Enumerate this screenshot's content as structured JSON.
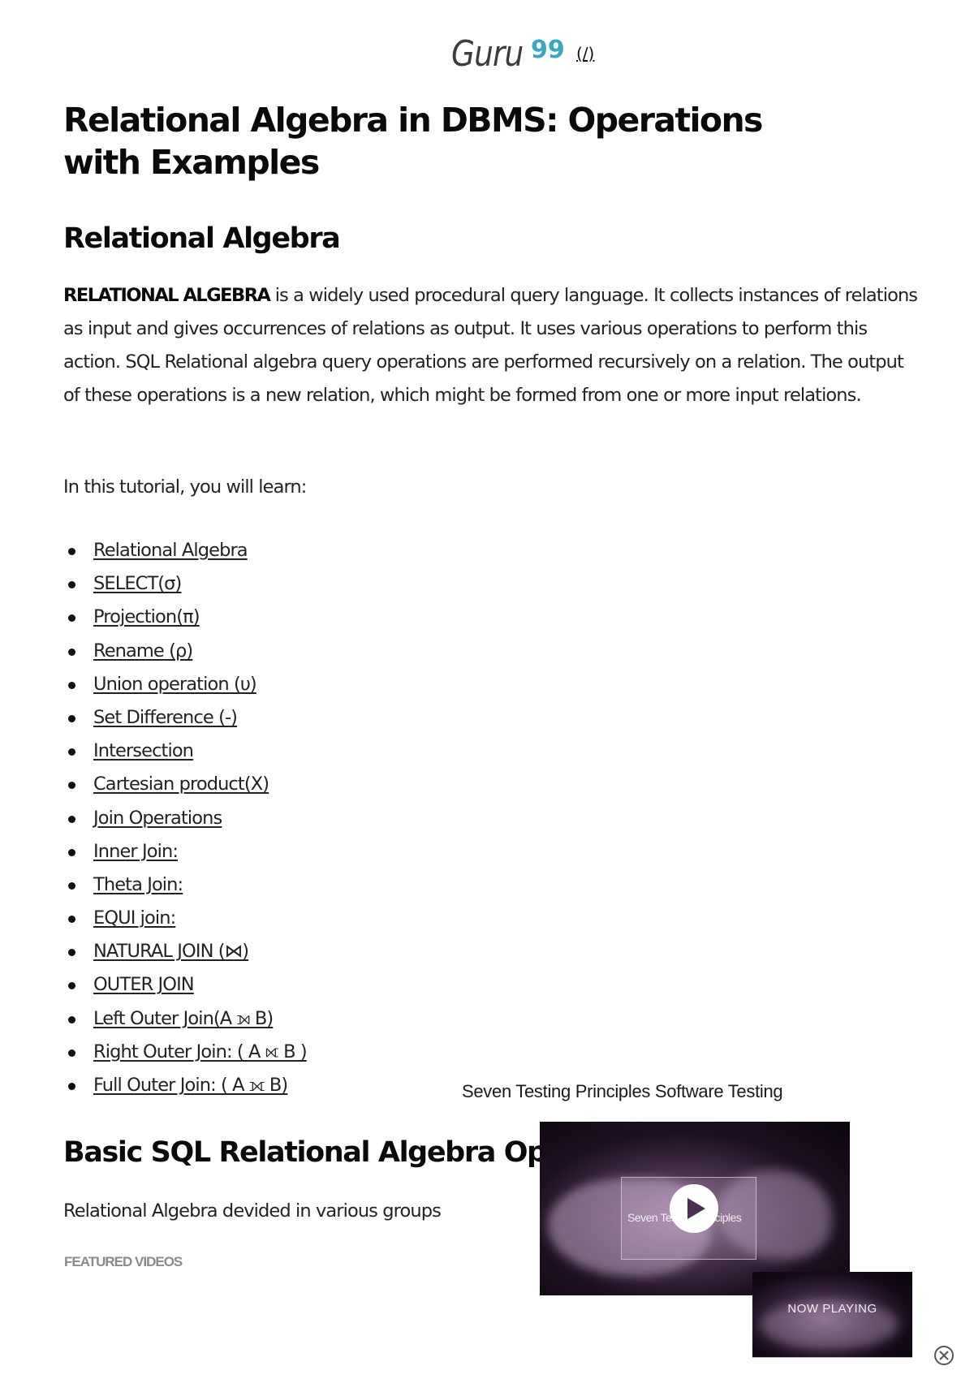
{
  "header": {
    "logo_text": "Guru",
    "logo_suffix": "99",
    "logo_link_text": "(/)",
    "accent_color": "#3aa6c0"
  },
  "article": {
    "title": "Relational Algebra in DBMS: Operations with Examples",
    "section1": {
      "heading": "Relational Algebra",
      "intro_bold": "RELATIONAL ALGEBRA",
      "intro_rest": " is a widely used procedural query language. It collects instances of relations as input and gives occurrences of relations as output. It uses various operations to perform this action. SQL Relational algebra query operations are performed recursively on a relation. The output of these operations is a new relation, which might be formed from one or more input relations.",
      "learn_intro": "In this tutorial, you will learn:"
    },
    "toc": [
      {
        "label": "Relational Algebra"
      },
      {
        "label": "SELECT(σ)"
      },
      {
        "label": "Projection(π)"
      },
      {
        "label": "Rename (ρ)"
      },
      {
        "label": "Union operation (υ)"
      },
      {
        "label": "Set Difference (-)"
      },
      {
        "label": "Intersection"
      },
      {
        "label": "Cartesian product(X)"
      },
      {
        "label": "Join Operations"
      },
      {
        "label": "Inner Join:"
      },
      {
        "label": "Theta Join:"
      },
      {
        "label": "EQUI join:"
      },
      {
        "label": "NATURAL JOIN (⋈)"
      },
      {
        "label": "OUTER JOIN"
      },
      {
        "label": "Left Outer Join(A ⟕ B)"
      },
      {
        "label": "Right Outer Join: ( A ⟖ B )"
      },
      {
        "label": "Full Outer Join: ( A ⟗ B)"
      }
    ],
    "section2": {
      "heading": "Basic SQL Relational Algebra Operat",
      "text": "Relational Algebra devided in various groups"
    },
    "featured_label": "FEATURED VIDEOS"
  },
  "video": {
    "title": "Seven Testing Principles Software Testing",
    "overlay_text": "Seven Testing Principles",
    "thumb_label": "NOW PLAYING",
    "play_icon": "play-icon",
    "close_icon": "close-circle-icon"
  }
}
